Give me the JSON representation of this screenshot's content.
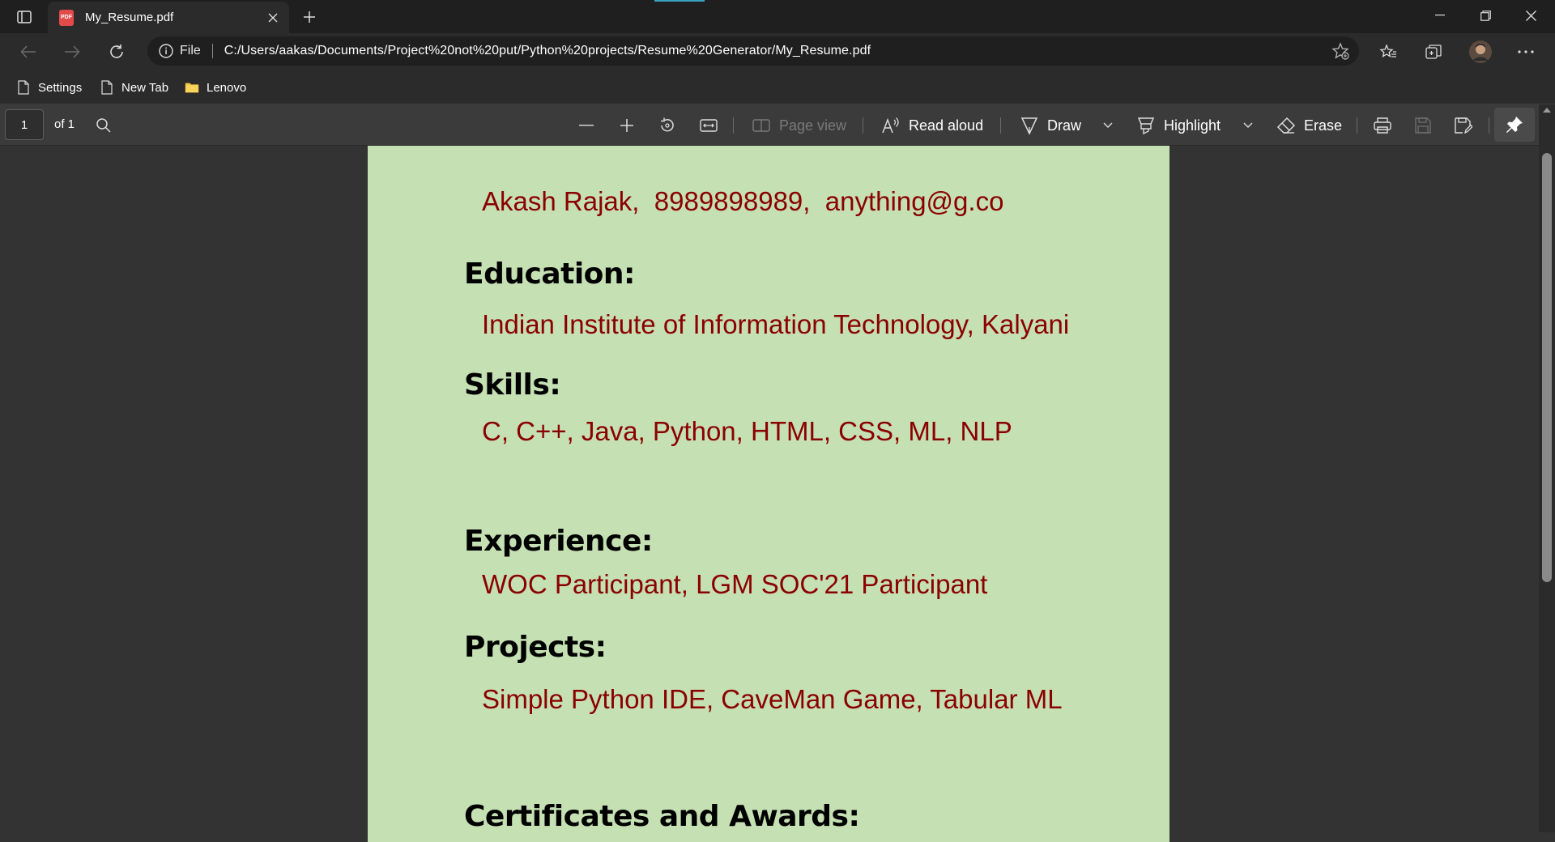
{
  "browser": {
    "tab": {
      "title": "My_Resume.pdf",
      "icon": "pdf-icon",
      "icon_text": "PDF"
    },
    "address": {
      "scheme_label": "File",
      "url": "C:/Users/aakas/Documents/Project%20not%20put/Python%20projects/Resume%20Generator/My_Resume.pdf"
    },
    "bookmarks": [
      {
        "label": "Settings",
        "icon": "page-icon"
      },
      {
        "label": "New Tab",
        "icon": "page-icon"
      },
      {
        "label": "Lenovo",
        "icon": "folder-icon"
      }
    ],
    "colors": {
      "accent": "#3aa0c0",
      "folder": "#f4c542"
    }
  },
  "pdf_toolbar": {
    "page_number": "1",
    "page_total": "of 1",
    "page_view_label": "Page view",
    "read_aloud_label": "Read aloud",
    "draw_label": "Draw",
    "highlight_label": "Highlight",
    "erase_label": "Erase"
  },
  "document": {
    "contact": "Akash Rajak,  8989898989,  anything@g.co",
    "sections": {
      "education": {
        "heading": "Education:",
        "text": "Indian Institute of Information Technology, Kalyani"
      },
      "skills": {
        "heading": "Skills:",
        "text": "C, C++, Java, Python, HTML, CSS, ML, NLP"
      },
      "experience": {
        "heading": "Experience:",
        "text": "WOC Participant, LGM SOC'21 Participant"
      },
      "projects": {
        "heading": "Projects:",
        "text": "Simple Python IDE, CaveMan Game, Tabular ML"
      },
      "certificates": {
        "heading": "Certificates and Awards:"
      }
    },
    "colors": {
      "page_bg": "#c5e0b3",
      "body_text": "#8b0000",
      "heading_text": "#000000"
    }
  }
}
